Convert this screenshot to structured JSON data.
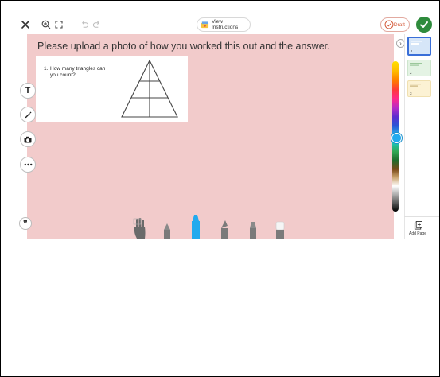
{
  "toolbar": {
    "close_icon": "close-icon",
    "zoom_icon": "zoom-in-icon",
    "fullscreen_icon": "fullscreen-icon",
    "undo_icon": "undo-icon",
    "redo_icon": "redo-icon",
    "view_instructions_label": "View Instructions",
    "draft_label": "Draft",
    "done_icon": "checkmark-icon"
  },
  "canvas": {
    "prompt_text": "Please upload a photo of how you worked this out and the answer.",
    "background_color": "#f2cbcb",
    "question_number": "1.",
    "question_text": "How many triangles can you count?"
  },
  "left_tools": [
    {
      "name": "text-tool",
      "label": "T"
    },
    {
      "name": "pen-tool",
      "icon": "pen-icon"
    },
    {
      "name": "camera-tool",
      "icon": "camera-icon"
    },
    {
      "name": "more-tool",
      "icon": "more-icon"
    }
  ],
  "comment_button": {
    "label": "❞"
  },
  "drawing_tools": [
    {
      "name": "hand-tool",
      "selected": false
    },
    {
      "name": "pencil-tool",
      "selected": false
    },
    {
      "name": "marker-tool",
      "selected": true,
      "color": "#22aaee"
    },
    {
      "name": "pen-fine-tool",
      "selected": false
    },
    {
      "name": "highlighter-tool",
      "selected": false
    },
    {
      "name": "eraser-tool",
      "selected": false
    }
  ],
  "color_palette": {
    "selected_color": "#22aaee"
  },
  "pages": {
    "items": [
      {
        "number": "1",
        "color": "#d6e6f8",
        "selected": true
      },
      {
        "number": "2",
        "color": "#e4f3e4",
        "selected": false
      },
      {
        "number": "3",
        "color": "#fcf2d4",
        "selected": false
      }
    ],
    "add_page_label": "Add Page"
  }
}
